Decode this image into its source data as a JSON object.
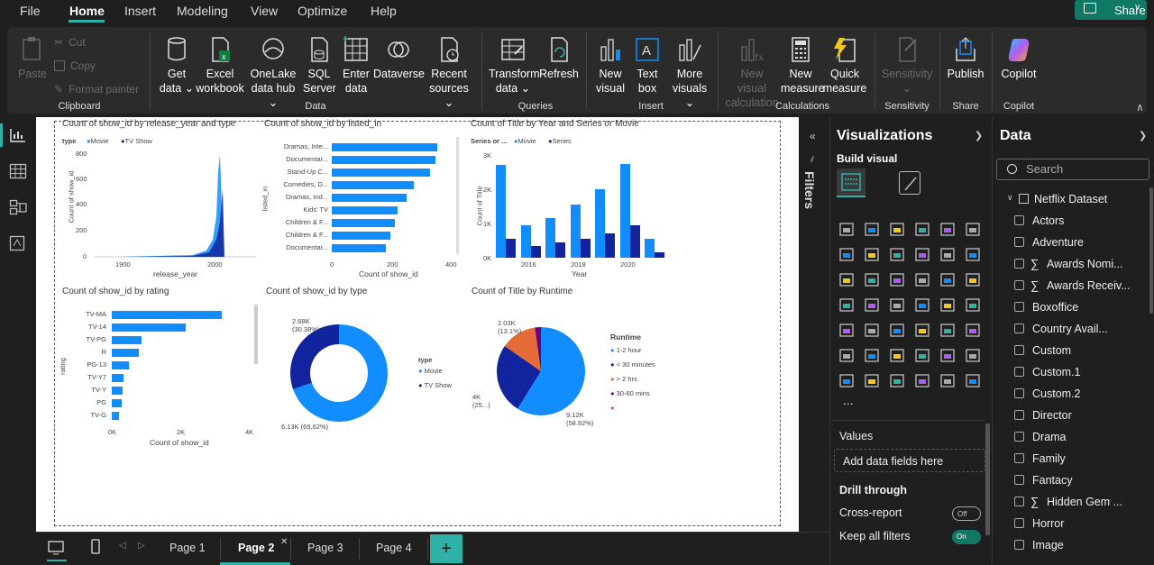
{
  "menu": {
    "items": [
      "File",
      "Home",
      "Insert",
      "Modeling",
      "View",
      "Optimize",
      "Help"
    ],
    "active": "Home",
    "share_label": "Share"
  },
  "ribbon": {
    "clipboard": {
      "paste": "Paste",
      "cut": "Cut",
      "copy": "Copy",
      "format_painter": "Format painter",
      "label": "Clipboard"
    },
    "data": {
      "get_data": [
        "Get",
        "data"
      ],
      "excel": [
        "Excel",
        "workbook"
      ],
      "onelake": [
        "OneLake",
        "data hub"
      ],
      "sql": [
        "SQL",
        "Server"
      ],
      "enter": [
        "Enter",
        "data"
      ],
      "dataverse": "Dataverse",
      "recent": [
        "Recent",
        "sources"
      ],
      "label": "Data"
    },
    "queries": {
      "transform": [
        "Transform",
        "data"
      ],
      "refresh": "Refresh",
      "label": "Queries"
    },
    "insert": {
      "new_visual": [
        "New",
        "visual"
      ],
      "text_box": [
        "Text",
        "box"
      ],
      "more_visuals": [
        "More",
        "visuals"
      ],
      "label": "Insert"
    },
    "calculations": {
      "new_visual_calc": [
        "New visual",
        "calculation"
      ],
      "new_measure": [
        "New",
        "measure"
      ],
      "quick_measure": [
        "Quick",
        "measure"
      ],
      "label": "Calculations"
    },
    "sensitivity": {
      "button": "Sensitivity",
      "label": "Sensitivity"
    },
    "share": {
      "publish": "Publish",
      "label": "Share"
    },
    "copilot": {
      "button": "Copilot",
      "label": "Copilot"
    }
  },
  "visuals": {
    "v1": {
      "title": "Count of show_id by release_year and type",
      "legend_title": "type",
      "legend": [
        "Movie",
        "TV Show"
      ],
      "yticks": [
        "800",
        "600",
        "400",
        "200",
        "0"
      ],
      "xticks": [
        "1900",
        "2000"
      ],
      "xlabel": "release_year",
      "ylabel": "Count of show_id"
    },
    "v2": {
      "title": "Count of show_id by listed_in",
      "categories": [
        "Dramas, Inte...",
        "Documentar...",
        "Stand-Up C...",
        "Comedies, D...",
        "Dramas, Ind...",
        "Kids' TV",
        "Children & F...",
        "Children & F...",
        "Documentar..."
      ],
      "values": [
        360,
        355,
        335,
        280,
        255,
        225,
        215,
        200,
        185
      ],
      "xticks": [
        "0",
        "200",
        "400"
      ],
      "xlabel": "Count of show_id",
      "ylabel": "listed_in"
    },
    "v3": {
      "title": "Count of Title by Year and Series or Movie",
      "legend_title": "Series or ...",
      "legend": [
        "Movie",
        "Series"
      ],
      "yticks": [
        "3K",
        "2K",
        "1K",
        "0K"
      ],
      "xticks": [
        "2016",
        "2018",
        "2020"
      ],
      "xlabel": "Year",
      "ylabel": "Count of Title",
      "movie": [
        2700,
        950,
        1150,
        1550,
        2000,
        2750,
        550
      ],
      "series": [
        550,
        350,
        450,
        550,
        700,
        950,
        150
      ]
    },
    "v4": {
      "title": "Count of show_id by rating",
      "categories": [
        "TV-MA",
        "TV-14",
        "TV-PG",
        "R",
        "PG-13",
        "TV-Y7",
        "TV-Y",
        "PG",
        "TV-G"
      ],
      "values": [
        3200,
        2150,
        860,
        800,
        490,
        330,
        310,
        290,
        220
      ],
      "xticks": [
        "0K",
        "2K",
        "4K"
      ],
      "xlabel": "Count of show_id",
      "ylabel": "rating"
    },
    "v5": {
      "title": "Count of show_id by type",
      "legend_title": "type",
      "legend": [
        "Movie",
        "TV Show"
      ],
      "label_tv": [
        "2.68K",
        "(30.38%)"
      ],
      "label_movie": "6.13K (69.62%)"
    },
    "v6": {
      "title": "Count of Title by Runtime",
      "legend_title": "Runtime",
      "legend": [
        "1-2 hour",
        "< 30 minutes",
        "> 2 hrs",
        "30-60 mins",
        ""
      ],
      "label_a": [
        "2.03K",
        "(13.1%)"
      ],
      "label_b": [
        "4K",
        "(25...)"
      ],
      "label_c": [
        "9.12K",
        "(58.92%)"
      ]
    }
  },
  "filters_label": "Filters",
  "viz_pane": {
    "title": "Visualizations",
    "build_visual": "Build visual",
    "more": "...",
    "values_label": "Values",
    "add_fields": "Add data fields here",
    "drill_through": "Drill through",
    "cross_report": "Cross-report",
    "cross_state": "Off",
    "keep_filters": "Keep all filters",
    "keep_state": "On"
  },
  "data_pane": {
    "title": "Data",
    "search_placeholder": "Search",
    "dataset": "Netflix Dataset",
    "fields": [
      {
        "name": "Actors",
        "sigma": false
      },
      {
        "name": "Adventure",
        "sigma": false
      },
      {
        "name": "Awards Nomi...",
        "sigma": true
      },
      {
        "name": "Awards Receiv...",
        "sigma": true
      },
      {
        "name": "Boxoffice",
        "sigma": false
      },
      {
        "name": "Country Avail...",
        "sigma": false
      },
      {
        "name": "Custom",
        "sigma": false
      },
      {
        "name": "Custom.1",
        "sigma": false
      },
      {
        "name": "Custom.2",
        "sigma": false
      },
      {
        "name": "Director",
        "sigma": false
      },
      {
        "name": "Drama",
        "sigma": false
      },
      {
        "name": "Family",
        "sigma": false
      },
      {
        "name": "Fantacy",
        "sigma": false
      },
      {
        "name": "Hidden Gem ...",
        "sigma": true
      },
      {
        "name": "Horror",
        "sigma": false
      },
      {
        "name": "Image",
        "sigma": false
      }
    ]
  },
  "pages": [
    "Page 1",
    "Page 2",
    "Page 3",
    "Page 4"
  ],
  "active_page": "Page 2",
  "colors": {
    "movie": "#118dff",
    "tv": "#12239e",
    "orange": "#e66c37",
    "purple": "#6b007b",
    "pink": "#e044a7",
    "accent": "#2fb1a7"
  }
}
